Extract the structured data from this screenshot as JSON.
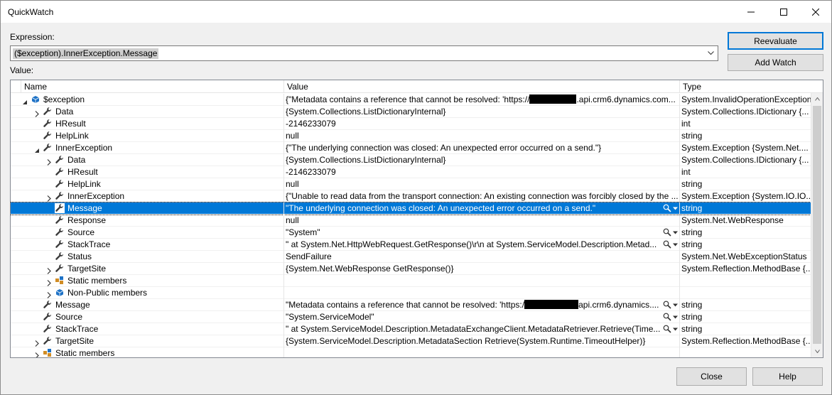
{
  "window": {
    "title": "QuickWatch"
  },
  "expression": {
    "label": "Expression:",
    "value": "($exception).InnerException.Message"
  },
  "value_label": "Value:",
  "buttons": {
    "reevaluate": "Reevaluate",
    "add_watch": "Add Watch",
    "close": "Close",
    "help": "Help"
  },
  "columns": {
    "name": "Name",
    "value": "Value",
    "type": "Type"
  },
  "rows": [
    {
      "depth": 0,
      "expander": "expanded",
      "icon": "object",
      "name": "$exception",
      "value_pre": "{\"Metadata contains a reference that cannot be resolved: 'https://",
      "value_post": ".api.crm6.dynamics.com...",
      "redacted": true,
      "type": "System.InvalidOperationException",
      "tools": ""
    },
    {
      "depth": 1,
      "expander": "collapsed",
      "icon": "wrench",
      "name": "Data",
      "value": "{System.Collections.ListDictionaryInternal}",
      "type": "System.Collections.IDictionary {...",
      "tools": ""
    },
    {
      "depth": 1,
      "expander": "none",
      "icon": "wrench",
      "name": "HResult",
      "value": "-2146233079",
      "type": "int",
      "tools": ""
    },
    {
      "depth": 1,
      "expander": "none",
      "icon": "wrench",
      "name": "HelpLink",
      "value": "null",
      "type": "string",
      "tools": ""
    },
    {
      "depth": 1,
      "expander": "expanded",
      "icon": "wrench",
      "name": "InnerException",
      "value": "{\"The underlying connection was closed: An unexpected error occurred on a send.\"}",
      "type": "System.Exception {System.Net....",
      "tools": ""
    },
    {
      "depth": 2,
      "expander": "collapsed",
      "icon": "wrench",
      "name": "Data",
      "value": "{System.Collections.ListDictionaryInternal}",
      "type": "System.Collections.IDictionary {...",
      "tools": ""
    },
    {
      "depth": 2,
      "expander": "none",
      "icon": "wrench",
      "name": "HResult",
      "value": "-2146233079",
      "type": "int",
      "tools": ""
    },
    {
      "depth": 2,
      "expander": "none",
      "icon": "wrench",
      "name": "HelpLink",
      "value": "null",
      "type": "string",
      "tools": ""
    },
    {
      "depth": 2,
      "expander": "collapsed",
      "icon": "wrench",
      "name": "InnerException",
      "value": "{\"Unable to read data from the transport connection: An existing connection was forcibly closed by the ...",
      "type": "System.Exception {System.IO.IO...",
      "tools": ""
    },
    {
      "depth": 2,
      "expander": "none",
      "icon": "wrench",
      "name": "Message",
      "value": "\"The underlying connection was closed: An unexpected error occurred on a send.\"",
      "type": "string",
      "tools": "magnifier",
      "selected": true
    },
    {
      "depth": 2,
      "expander": "none",
      "icon": "wrench",
      "name": "Response",
      "value": "null",
      "type": "System.Net.WebResponse",
      "tools": ""
    },
    {
      "depth": 2,
      "expander": "none",
      "icon": "wrench",
      "name": "Source",
      "value": "\"System\"",
      "type": "string",
      "tools": "magnifier"
    },
    {
      "depth": 2,
      "expander": "none",
      "icon": "wrench",
      "name": "StackTrace",
      "value": "\"   at System.Net.HttpWebRequest.GetResponse()\\r\\n   at System.ServiceModel.Description.Metad...",
      "type": "string",
      "tools": "magnifier"
    },
    {
      "depth": 2,
      "expander": "none",
      "icon": "wrench",
      "name": "Status",
      "value": "SendFailure",
      "type": "System.Net.WebExceptionStatus",
      "tools": ""
    },
    {
      "depth": 2,
      "expander": "collapsed",
      "icon": "wrench",
      "name": "TargetSite",
      "value": "{System.Net.WebResponse GetResponse()}",
      "type": "System.Reflection.MethodBase {...",
      "tools": ""
    },
    {
      "depth": 2,
      "expander": "collapsed",
      "icon": "static",
      "name": "Static members",
      "value": "",
      "type": "",
      "tools": ""
    },
    {
      "depth": 2,
      "expander": "collapsed",
      "icon": "object",
      "name": "Non-Public members",
      "value": "",
      "type": "",
      "tools": ""
    },
    {
      "depth": 1,
      "expander": "none",
      "icon": "wrench",
      "name": "Message",
      "value_pre": "\"Metadata contains a reference that cannot be resolved: 'https:/",
      "value_post": "api.crm6.dynamics....",
      "redacted": true,
      "type": "string",
      "tools": "magnifier"
    },
    {
      "depth": 1,
      "expander": "none",
      "icon": "wrench",
      "name": "Source",
      "value": "\"System.ServiceModel\"",
      "type": "string",
      "tools": "magnifier"
    },
    {
      "depth": 1,
      "expander": "none",
      "icon": "wrench",
      "name": "StackTrace",
      "value": "\"   at System.ServiceModel.Description.MetadataExchangeClient.MetadataRetriever.Retrieve(Time...",
      "type": "string",
      "tools": "magnifier"
    },
    {
      "depth": 1,
      "expander": "collapsed",
      "icon": "wrench",
      "name": "TargetSite",
      "value": "{System.ServiceModel.Description.MetadataSection Retrieve(System.Runtime.TimeoutHelper)}",
      "type": "System.Reflection.MethodBase {...",
      "tools": ""
    },
    {
      "depth": 1,
      "expander": "collapsed",
      "icon": "static",
      "name": "Static members",
      "value": "",
      "type": "",
      "tools": ""
    }
  ],
  "colors": {
    "selection": "#0078d7",
    "object_icon": "#1e72c6",
    "static_icon": "#d08c24"
  }
}
